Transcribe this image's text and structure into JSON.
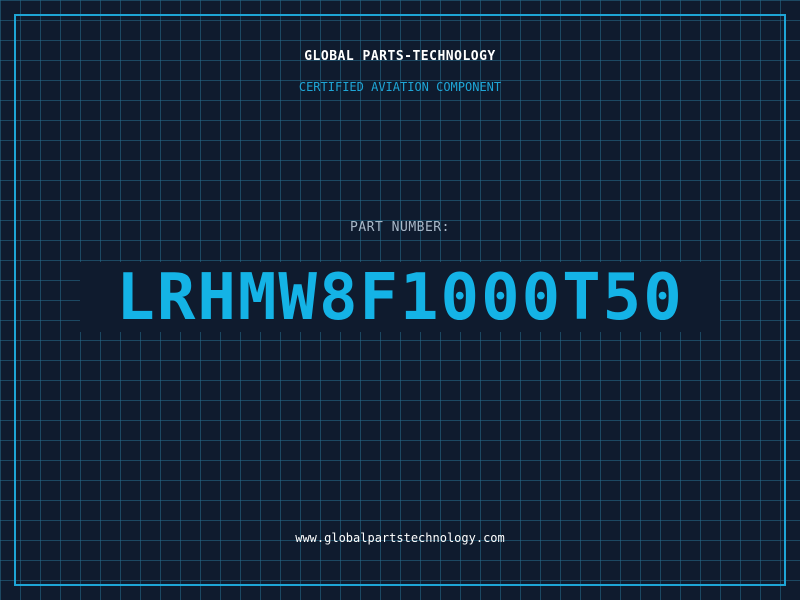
{
  "header": {
    "company": "GLOBAL PARTS-TECHNOLOGY",
    "subtitle": "CERTIFIED AVIATION COMPONENT"
  },
  "part": {
    "label": "PART NUMBER:",
    "number": "LRHMW8F1000T50"
  },
  "footer": {
    "website": "www.globalpartstechnology.com"
  },
  "colors": {
    "background": "#0f1b2e",
    "accent": "#1ea5d6",
    "part_number": "#14b3e6",
    "label": "#a9b8c8",
    "text": "#ffffff"
  }
}
